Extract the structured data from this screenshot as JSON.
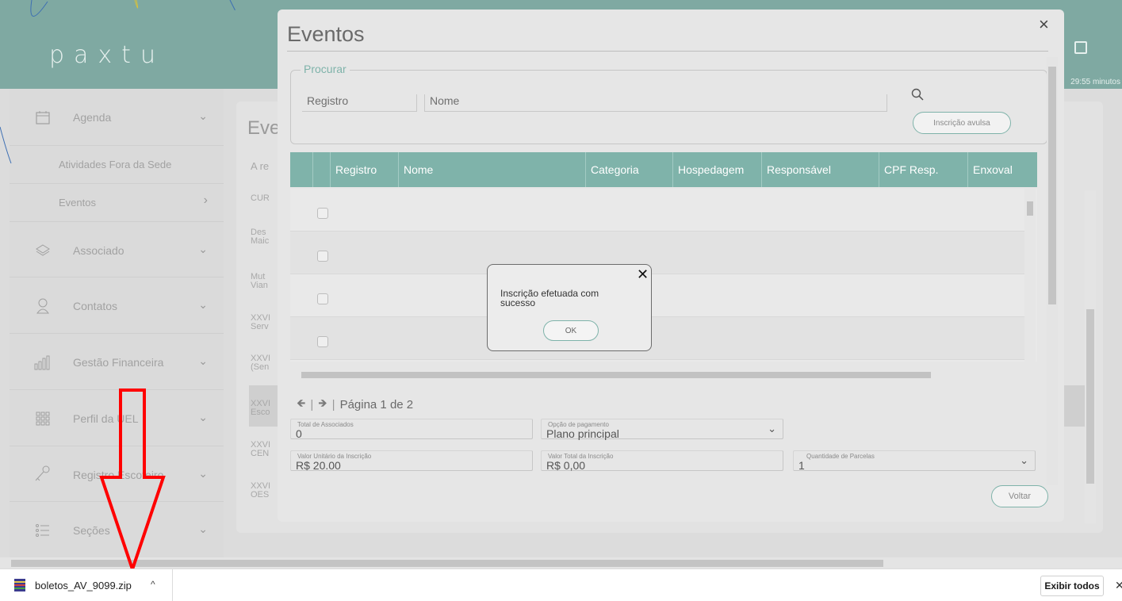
{
  "app": {
    "logo": "paxtu",
    "timer": "29:55 minutos"
  },
  "sidebar": {
    "items": [
      {
        "label": "Agenda"
      },
      {
        "label": "Atividades Fora da Sede"
      },
      {
        "label": "Eventos"
      },
      {
        "label": "Associado"
      },
      {
        "label": "Contatos"
      },
      {
        "label": "Gestão Financeira"
      },
      {
        "label": "Perfil da UEL"
      },
      {
        "label": "Registro Escoteiro"
      },
      {
        "label": "Seções"
      }
    ]
  },
  "background": {
    "title": "Eve",
    "filter_prefix": "A re",
    "rows": [
      "CUR",
      "Des\nMaic",
      "Mut\nVian",
      "XXVI\nServ",
      "XXVI\n(Sen",
      "XXVI\nEsco",
      "XXVI\nCEN",
      "XXVI\nOES"
    ]
  },
  "modal": {
    "title": "Eventos",
    "close": "×",
    "search": {
      "legend": "Procurar",
      "registro_placeholder": "Registro",
      "nome_placeholder": "Nome",
      "avulsa_button": "Inscrição avulsa"
    },
    "table": {
      "columns": [
        "Registro",
        "Nome",
        "Categoria",
        "Hospedagem",
        "Responsável",
        "CPF Resp.",
        "Enxoval"
      ]
    },
    "pager": {
      "prev": "🡸",
      "next": "🡺",
      "separator": "|",
      "label": "Página 1 de 2"
    },
    "form": {
      "total_associados_label": "Total de Associados",
      "total_associados": "0",
      "opcao_pagamento_label": "Opção de pagamento",
      "opcao_pagamento": "Plano principal",
      "valor_unitario_label": "Valor Unitário da Inscrição",
      "valor_unitario": "R$ 20.00",
      "valor_total_label": "Valor Total da Inscrição",
      "valor_total": "R$ 0,00",
      "parcelas_label": "Quantidade de Parcelas",
      "parcelas": "1"
    },
    "voltar_button": "Voltar"
  },
  "alert": {
    "close": "✕",
    "message": "Inscrição efetuada com sucesso",
    "ok_button": "OK"
  },
  "downloads": {
    "file_name": "boletos_AV_9099.zip",
    "caret": "^",
    "show_all": "Exibir todos",
    "close": "✕"
  },
  "colors": {
    "teal": "#7fb3aa",
    "header": "#7fa9a2",
    "annotation": "#ff0000"
  }
}
